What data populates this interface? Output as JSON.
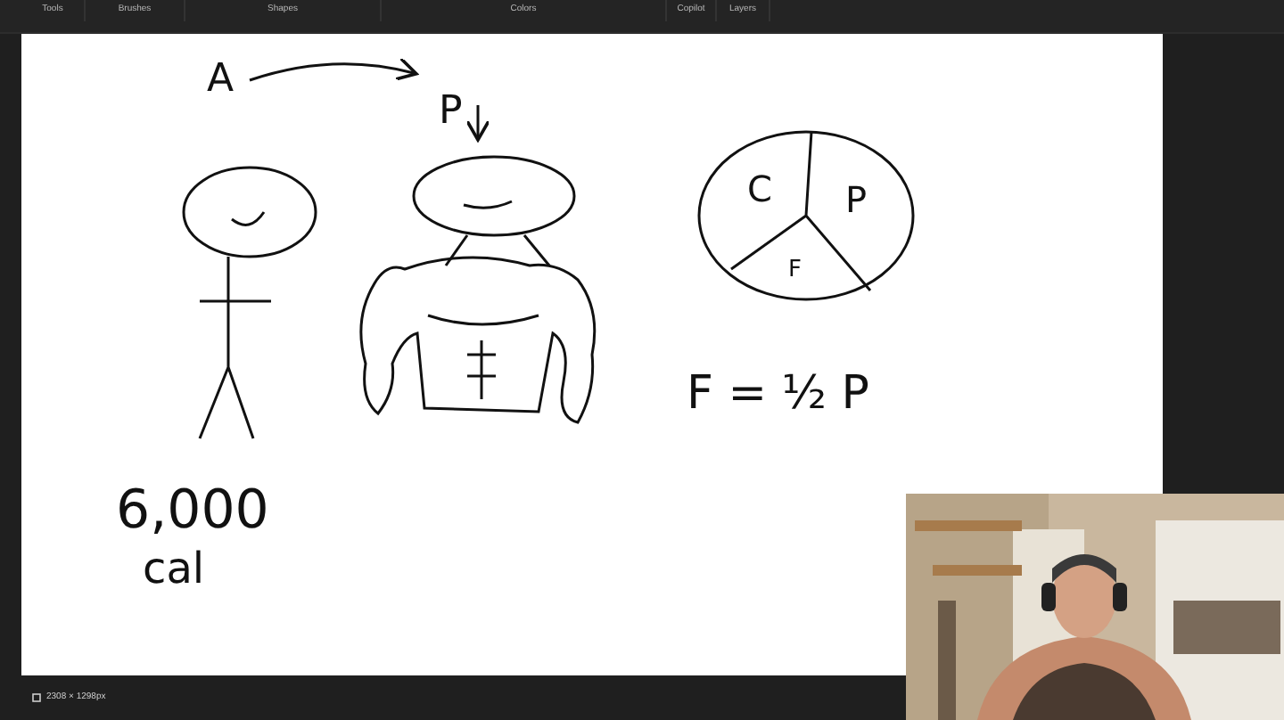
{
  "toolbar": {
    "tabs": [
      "Tools",
      "Brushes",
      "Shapes",
      "Colors",
      "Copilot",
      "Layers"
    ]
  },
  "canvas": {
    "notes": [
      "A",
      "P",
      "C",
      "P",
      "F",
      "F = ½ P",
      "6,000",
      "cal"
    ]
  },
  "status_bar": {
    "dimensions": "2308 × 1298px"
  }
}
